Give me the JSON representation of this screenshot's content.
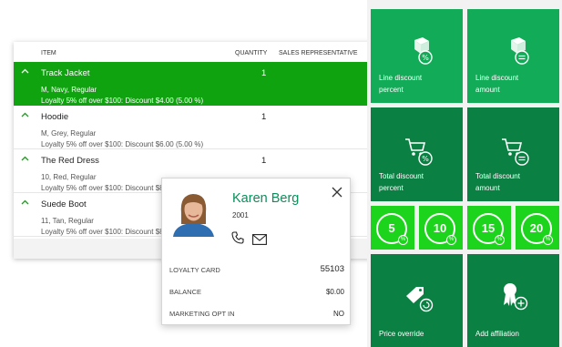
{
  "grid": {
    "headers": {
      "item": "ITEM",
      "quantity": "QUANTITY",
      "sales_rep": "SALES REPRESENTATIVE"
    },
    "rows": [
      {
        "name": "Track Jacket",
        "qty": "1",
        "desc": "M, Navy, Regular",
        "discount": "Loyalty 5% off over $100: Discount $4.00 (5.00 %)",
        "selected": true
      },
      {
        "name": "Hoodie",
        "qty": "1",
        "desc": "M, Grey, Regular",
        "discount": "Loyalty 5% off over $100: Discount $6.00 (5.00 %)",
        "selected": false
      },
      {
        "name": "The Red Dress",
        "qty": "1",
        "desc": "10, Red, Regular",
        "discount": "Loyalty 5% off over $100: Discount $8.00 (5.00 %)",
        "selected": false
      },
      {
        "name": "Suede Boot",
        "qty": "",
        "desc": "11, Tan, Regular",
        "discount": "Loyalty 5% off over $100: Discount $8.00 (5.00 %)",
        "selected": false
      }
    ]
  },
  "customer": {
    "name": "Karen Berg",
    "id": "2001",
    "loyalty_label": "LOYALTY CARD",
    "loyalty_value": "55103",
    "balance_label": "BALANCE",
    "balance_value": "$0.00",
    "marketing_label": "MARKETING OPT IN",
    "marketing_value": "NO"
  },
  "tiles": {
    "line_discount_percent": [
      "Line discount",
      "percent"
    ],
    "line_discount_amount": [
      "Line discount",
      "amount"
    ],
    "total_discount_percent": [
      "Total discount",
      "percent"
    ],
    "total_discount_amount": [
      "Total discount",
      "amount"
    ],
    "quick": [
      "5",
      "10",
      "15",
      "20"
    ],
    "price_override": "Price override",
    "add_affiliation": "Add affiliation"
  },
  "colors": {
    "selected_row": "#10a310",
    "tile_green": "#12ab57",
    "tile_dark": "#0b8043",
    "tile_bright": "#1bd41b",
    "customer_name": "#0a8f5a"
  },
  "icons": {
    "row": "chevron-up-icon",
    "close": "close-icon",
    "phone": "phone-icon",
    "mail": "mail-icon",
    "line_discount": "box-percent-icon",
    "total_discount": "cart-percent-icon",
    "price_override": "tag-icon",
    "add_affiliation": "ribbon-plus-icon"
  }
}
